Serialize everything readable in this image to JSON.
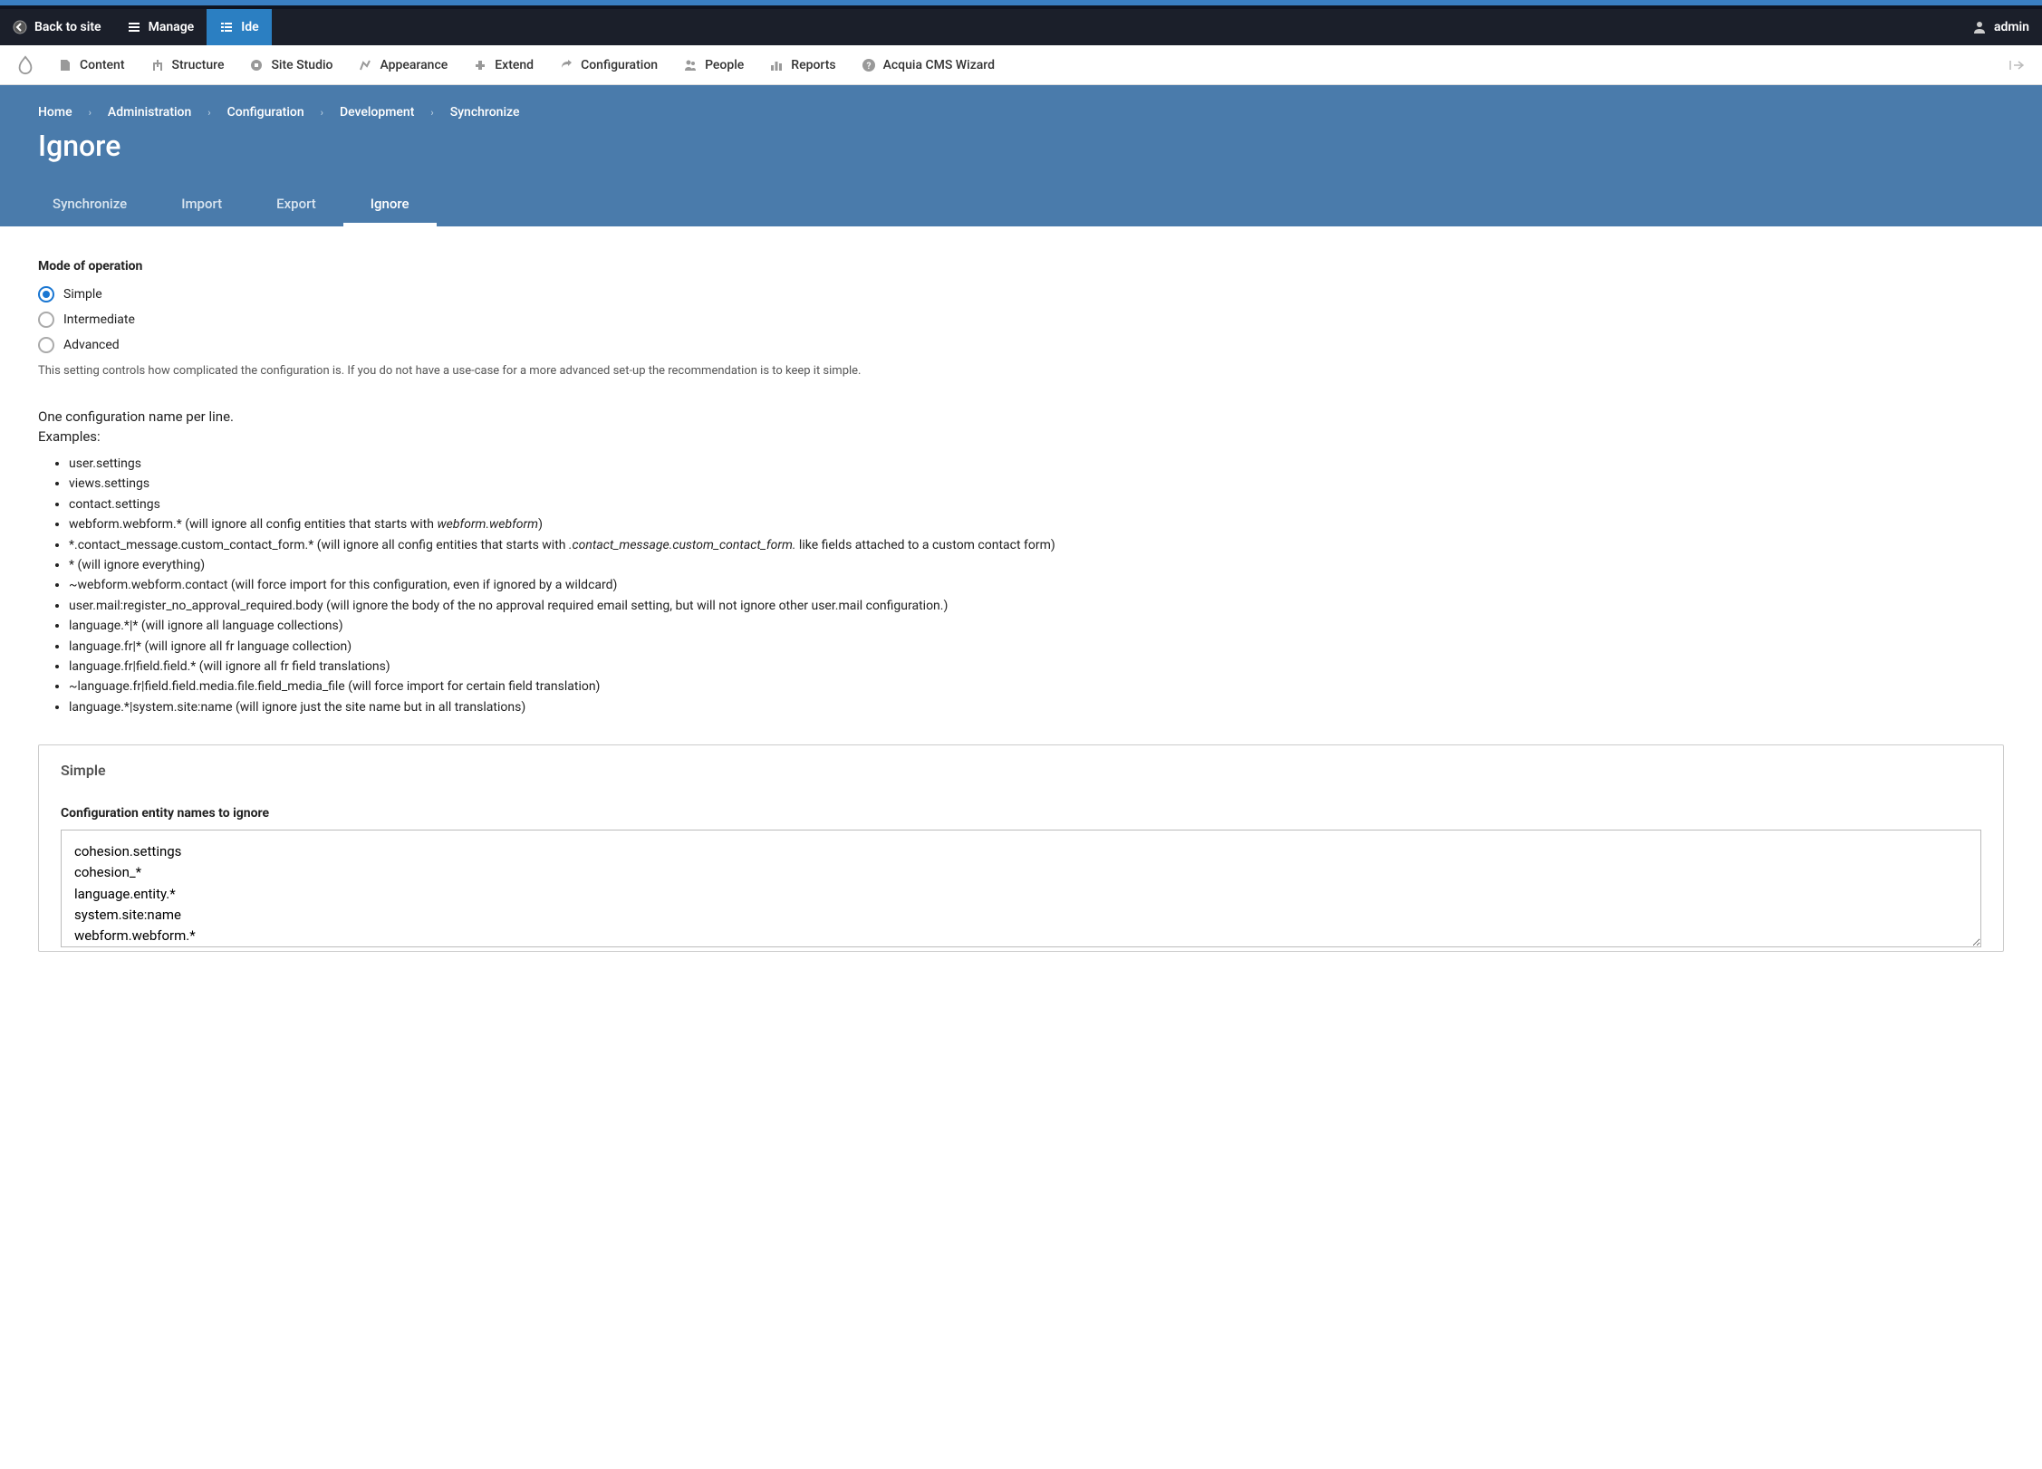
{
  "toolbar": {
    "back_label": "Back to site",
    "manage_label": "Manage",
    "ide_label": "Ide",
    "user_label": "admin"
  },
  "menu": {
    "items": [
      {
        "label": "Content"
      },
      {
        "label": "Structure"
      },
      {
        "label": "Site Studio"
      },
      {
        "label": "Appearance"
      },
      {
        "label": "Extend"
      },
      {
        "label": "Configuration"
      },
      {
        "label": "People"
      },
      {
        "label": "Reports"
      },
      {
        "label": "Acquia CMS Wizard"
      }
    ]
  },
  "breadcrumb": [
    "Home",
    "Administration",
    "Configuration",
    "Development",
    "Synchronize"
  ],
  "page_title": "Ignore",
  "tabs": [
    {
      "label": "Synchronize",
      "active": false
    },
    {
      "label": "Import",
      "active": false
    },
    {
      "label": "Export",
      "active": false
    },
    {
      "label": "Ignore",
      "active": true
    }
  ],
  "mode": {
    "label": "Mode of operation",
    "options": [
      {
        "label": "Simple",
        "checked": true
      },
      {
        "label": "Intermediate",
        "checked": false
      },
      {
        "label": "Advanced",
        "checked": false
      }
    ],
    "help": "This setting controls how complicated the configuration is. If you do not have a use-case for a more advanced set-up the recommendation is to keep it simple."
  },
  "desc_line1": "One configuration name per line.",
  "desc_line2": "Examples:",
  "examples": [
    {
      "pre": "user.settings",
      "em": "",
      "post": ""
    },
    {
      "pre": "views.settings",
      "em": "",
      "post": ""
    },
    {
      "pre": "contact.settings",
      "em": "",
      "post": ""
    },
    {
      "pre": "webform.webform.* (will ignore all config entities that starts with ",
      "em": "webform.webform",
      "post": ")"
    },
    {
      "pre": "*.contact_message.custom_contact_form.* (will ignore all config entities that starts with ",
      "em": ".contact_message.custom_contact_form.",
      "post": " like fields attached to a custom contact form)"
    },
    {
      "pre": "* (will ignore everything)",
      "em": "",
      "post": ""
    },
    {
      "pre": "~webform.webform.contact (will force import for this configuration, even if ignored by a wildcard)",
      "em": "",
      "post": ""
    },
    {
      "pre": "user.mail:register_no_approval_required.body (will ignore the body of the no approval required email setting, but will not ignore other user.mail configuration.)",
      "em": "",
      "post": ""
    },
    {
      "pre": "language.*|* (will ignore all language collections)",
      "em": "",
      "post": ""
    },
    {
      "pre": "language.fr|* (will ignore all fr language collection)",
      "em": "",
      "post": ""
    },
    {
      "pre": "language.fr|field.field.* (will ignore all fr field translations)",
      "em": "",
      "post": ""
    },
    {
      "pre": "~language.fr|field.field.media.file.field_media_file (will force import for certain field translation)",
      "em": "",
      "post": ""
    },
    {
      "pre": "language.*|system.site:name (will ignore just the site name but in all translations)",
      "em": "",
      "post": ""
    }
  ],
  "fieldset": {
    "legend": "Simple",
    "field_label": "Configuration entity names to ignore",
    "value": "cohesion.settings\ncohesion_*\nlanguage.entity.*\nsystem.site:name\nwebform.webform.*"
  }
}
